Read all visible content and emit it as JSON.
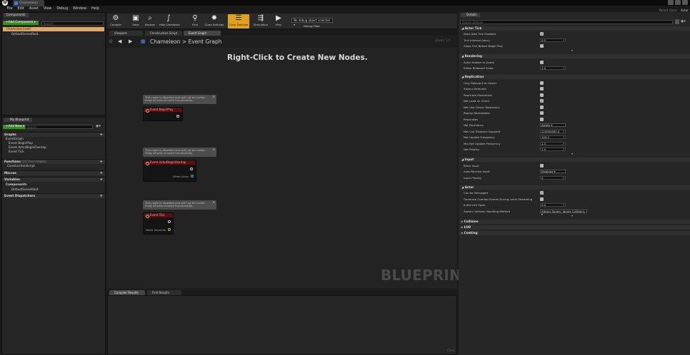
{
  "window": {
    "doc_tab": "Chameleon",
    "parent_class_label": "Parent class:",
    "parent_class_value": "Actor"
  },
  "menu": [
    "File",
    "Edit",
    "Asset",
    "View",
    "Debug",
    "Window",
    "Help"
  ],
  "components": {
    "tab": "Components",
    "add_button": "+Add Component ▾",
    "search_placeholder": "Search",
    "items": [
      "Chameleon(self)",
      "DefaultSceneRoot"
    ]
  },
  "my_blueprint": {
    "tab": "My Blueprint",
    "add_button": "+Add New ▾",
    "search_placeholder": "Search",
    "graphs_header": "Graphs",
    "event_graph": "EventGraph",
    "events": [
      "Event BeginPlay",
      "Event ActorBeginOverlap",
      "Event Tick"
    ],
    "functions_header": "Functions",
    "functions_note": "(10 Overridable)",
    "functions": [
      "ConstructionScript"
    ],
    "macros_header": "Macros",
    "variables_header": "Variables",
    "components_header": "Components",
    "components": [
      "DefaultSceneRoot"
    ],
    "dispatchers_header": "Event Dispatchers"
  },
  "toolbar": {
    "buttons": [
      "Compile",
      "Save",
      "Browse",
      "Hide Unrelated",
      "Find",
      "Class Settings",
      "Class Defaults",
      "Simulation",
      "Play"
    ],
    "debug_select": "No debug object selected ▾",
    "debug_label": "Debug Filter"
  },
  "editor_tabs": [
    "Viewport",
    "Construction Script",
    "Event Graph"
  ],
  "graph": {
    "breadcrumb_root": "Chameleon",
    "breadcrumb_sep": ">",
    "breadcrumb_leaf": "Event Graph",
    "hint": "Right-Click to Create New Nodes.",
    "zoom": "Zoom 1:1",
    "watermark": "BLUEPRINT",
    "warning_line1": "This node is disabled and will not be called.",
    "warning_line2": "Drag off pins to build functionality.",
    "nodes": [
      {
        "title": "Event BeginPlay",
        "pin_label": ""
      },
      {
        "title": "Event ActorBeginOverlap",
        "pin_label": "Other Actor"
      },
      {
        "title": "Event Tick",
        "pin_label": "Delta Seconds"
      }
    ]
  },
  "bottom": {
    "tabs": [
      "Compiler Results",
      "Find Results"
    ],
    "clear": "Clear"
  },
  "details": {
    "tab": "Details",
    "search_placeholder": "Search Details",
    "categories": {
      "actor_tick": "Actor Tick",
      "rendering": "Rendering",
      "replication": "Replication",
      "input": "Input",
      "actor": "Actor",
      "collision": "Collision",
      "lod": "LOD",
      "cooking": "Cooking"
    },
    "actor_tick": {
      "start_with_tick": "Start with Tick Enabled",
      "tick_interval": "Tick Interval (secs)",
      "tick_interval_value": "0.0",
      "allow_tick_before": "Allow Tick Before Begin Play"
    },
    "rendering": {
      "actor_hidden": "Actor Hidden In Game",
      "billboard_scale": "Editor Billboard Scale",
      "billboard_value": "1.0"
    },
    "replication": {
      "only_relevant_owner": "Only Relevant to Owner",
      "always_relevant": "Always Relevant",
      "replicate_movement": "Replicate Movement",
      "net_load_client": "Net Load on Client",
      "net_use_owner": "Net Use Owner Relevancy",
      "replay_rewindable": "Replay Rewindable",
      "replicates": "Replicates",
      "net_dormancy": "Net Dormancy",
      "net_dormancy_value": "Awake ▾",
      "net_cull": "Net Cull Distance Squared",
      "net_cull_value": "225000000.0",
      "net_update": "Net Update Frequency",
      "net_update_value": "100.0",
      "min_net_update": "Min Net Update Frequency",
      "min_net_update_value": "2.0",
      "net_priority": "Net Priority",
      "net_priority_value": "1.0"
    },
    "input": {
      "block_input": "Block Input",
      "auto_receive": "Auto Receive Input",
      "auto_receive_value": "Disabled ▾",
      "input_priority": "Input Priority",
      "input_priority_value": "0"
    },
    "actor": {
      "can_be_damaged": "Can be Damaged",
      "gen_overlap": "Generate Overlap Events During Level Streaming",
      "initial_life": "Initial Life Span",
      "initial_life_value": "0.0",
      "spawn_collision": "Spawn Collision Handling Method",
      "spawn_collision_value": "Always Spawn, Ignore Collisions ▾"
    }
  }
}
